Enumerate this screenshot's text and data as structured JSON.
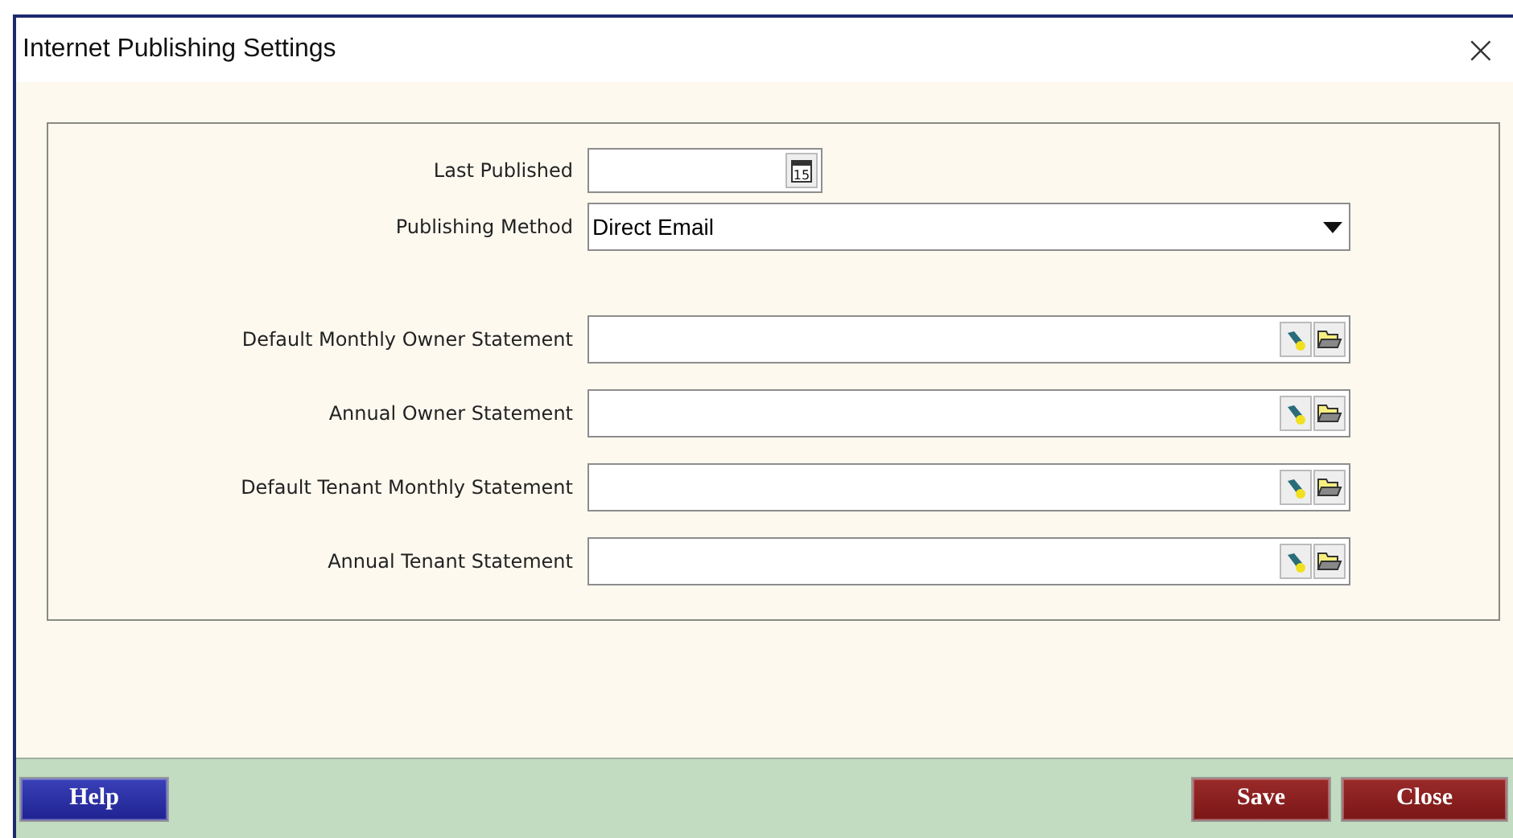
{
  "window": {
    "title": "Internet Publishing Settings",
    "close": "×"
  },
  "last_published": {
    "label": "Last Published",
    "calendar_day": "15"
  },
  "publishing_method": {
    "label": "Publishing Method",
    "value": "Direct Email"
  },
  "statements": [
    {
      "label": "Default Monthly Owner Statement"
    },
    {
      "label": "Annual Owner Statement"
    },
    {
      "label": "Default Tenant Monthly Statement"
    },
    {
      "label": "Annual Tenant Statement"
    }
  ],
  "buttons": [
    {
      "label": "Help",
      "kind": "help"
    },
    {
      "label": "Save",
      "kind": "action"
    },
    {
      "label": "Close",
      "kind": "action"
    }
  ]
}
